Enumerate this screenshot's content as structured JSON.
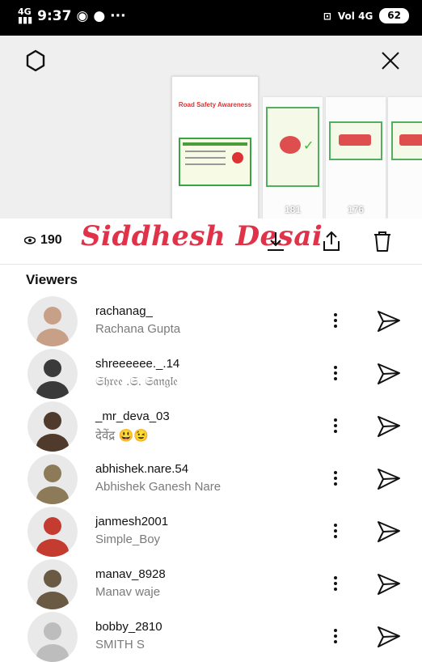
{
  "status_bar": {
    "network_label": "4G",
    "time": "9:37",
    "right_text": "Vol 4G",
    "battery": "62"
  },
  "story_thumbnails": [
    {
      "views": "190",
      "title": "Road Safety Awareness"
    },
    {
      "views": "181"
    },
    {
      "views": "176"
    },
    {
      "views": ""
    }
  ],
  "action_row": {
    "view_count": "190",
    "signature": "Siddhesh Desai"
  },
  "viewers": {
    "title": "Viewers",
    "items": [
      {
        "username": "rachanag_",
        "name": "Rachana Gupta",
        "avatar_color": "#c8a088"
      },
      {
        "username": "shreeeeee._.14",
        "name": "𝔖𝔥𝔯𝔢𝔢 .𝔖. 𝔖𝔞𝔫𝔤𝔩𝔢",
        "avatar_color": "#3a3a3a"
      },
      {
        "username": "_mr_deva_03",
        "name": "देवेंद्र 😃😉",
        "avatar_color": "#4f3a2c"
      },
      {
        "username": "abhishek.nare.54",
        "name": "Abhishek Ganesh Nare",
        "avatar_color": "#8c7a58"
      },
      {
        "username": "janmesh2001",
        "name": "Simple_Boy",
        "avatar_color": "#c43b2f"
      },
      {
        "username": "manav_8928",
        "name": "Manav  waje",
        "avatar_color": "#6a5a44"
      },
      {
        "username": "bobby_2810",
        "name": "SMITH S",
        "avatar_color": "#bdbdbd"
      }
    ]
  },
  "colors": {
    "signature": "#e0334a",
    "poster_green": "#3aa34a"
  }
}
